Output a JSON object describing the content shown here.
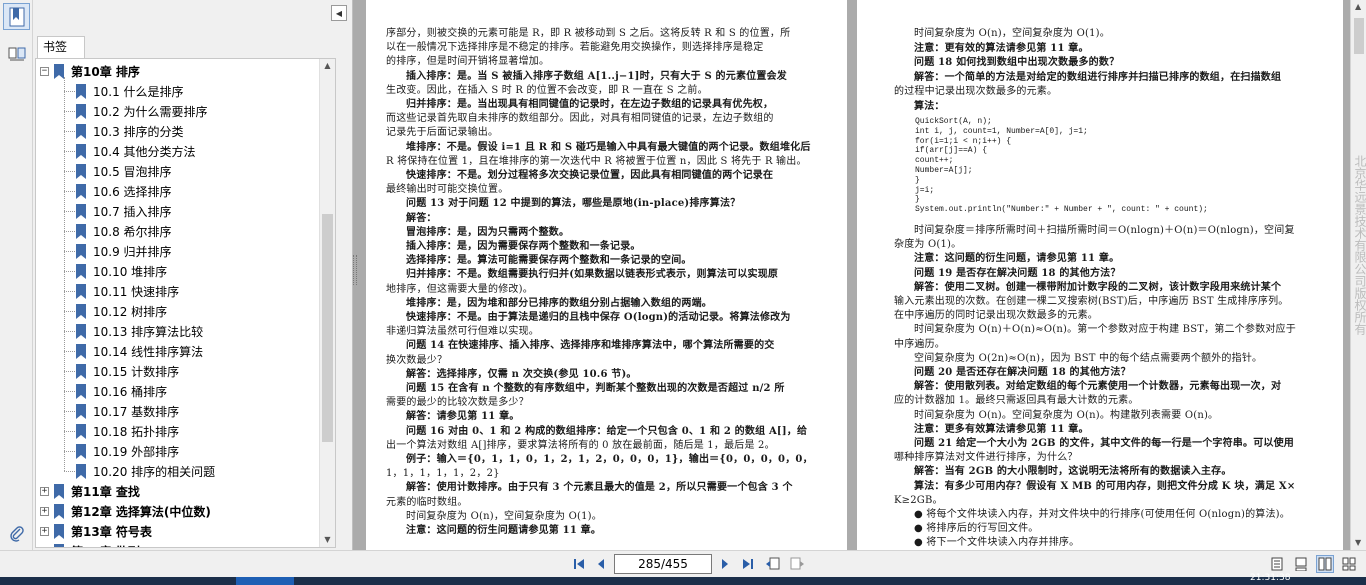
{
  "sidebar": {
    "tab_label": "书签",
    "collapse_label": "◀",
    "tree": [
      {
        "label": "第10章 排序",
        "level": 0,
        "expanded": true,
        "bold": true
      },
      {
        "label": "10.1 什么是排序",
        "level": 1
      },
      {
        "label": "10.2 为什么需要排序",
        "level": 1
      },
      {
        "label": "10.3 排序的分类",
        "level": 1
      },
      {
        "label": "10.4 其他分类方法",
        "level": 1
      },
      {
        "label": "10.5 冒泡排序",
        "level": 1
      },
      {
        "label": "10.6 选择排序",
        "level": 1
      },
      {
        "label": "10.7 插入排序",
        "level": 1
      },
      {
        "label": "10.8 希尔排序",
        "level": 1
      },
      {
        "label": "10.9 归并排序",
        "level": 1
      },
      {
        "label": "10.10 堆排序",
        "level": 1
      },
      {
        "label": "10.11 快速排序",
        "level": 1
      },
      {
        "label": "10.12 树排序",
        "level": 1
      },
      {
        "label": "10.13 排序算法比较",
        "level": 1
      },
      {
        "label": "10.14 线性排序算法",
        "level": 1
      },
      {
        "label": "10.15 计数排序",
        "level": 1
      },
      {
        "label": "10.16 桶排序",
        "level": 1
      },
      {
        "label": "10.17 基数排序",
        "level": 1
      },
      {
        "label": "10.18 拓扑排序",
        "level": 1
      },
      {
        "label": "10.19 外部排序",
        "level": 1
      },
      {
        "label": "10.20 排序的相关问题",
        "level": 1
      },
      {
        "label": "第11章 查找",
        "level": 0,
        "expanded": false,
        "bold": true
      },
      {
        "label": "第12章 选择算法(中位数)",
        "level": 0,
        "expanded": false,
        "bold": true
      },
      {
        "label": "第13章 符号表",
        "level": 0,
        "expanded": false,
        "bold": true
      },
      {
        "label": "第14章 散列",
        "level": 0,
        "expanded": false,
        "bold": true
      }
    ]
  },
  "page_left": {
    "lines": [
      {
        "text": "序部分，则被交换的元素可能是 R，即 R 被移动到 S 之后。这将反转 R 和 S 的位置，所",
        "indent": 0
      },
      {
        "text": "以在一般情况下选择排序是不稳定的排序。若能避免用交换操作，则选择排序是稳定",
        "indent": 0
      },
      {
        "text": "的排序，但是时间开销将显著增加。",
        "indent": 0
      },
      {
        "text": "插入排序：是。当 S 被插入排序子数组 A[1..j−1]时，只有大于 S 的元素位置会发",
        "indent": 1
      },
      {
        "text": "生改变。因此，在插入 S 时 R 的位置不会改变，即 R 一直在 S 之前。",
        "indent": 0
      },
      {
        "text": "归并排序：是。当出现具有相同键值的记录时，在左边子数组的记录具有优先权，",
        "indent": 1
      },
      {
        "text": "而这些记录首先取自未排序的数组部分。因此，对具有相同键值的记录，左边子数组的",
        "indent": 0
      },
      {
        "text": "记录先于后面记录输出。",
        "indent": 0
      },
      {
        "text": "堆排序：不是。假设 i=1 且 R 和 S 碰巧是输入中具有最大键值的两个记录。数组堆化后",
        "indent": 1
      },
      {
        "text": "R 将保持在位置 1，且在堆排序的第一次迭代中 R 将被置于位置 n，因此 S 将先于 R 输出。",
        "indent": 0
      },
      {
        "text": "快速排序：不是。划分过程将多次交换记录位置，因此具有相同键值的两个记录在",
        "indent": 1
      },
      {
        "text": "最终输出时可能交换位置。",
        "indent": 0
      },
      {
        "text": "问题 13   对于问题 12 中提到的算法，哪些是原地(in-place)排序算法？",
        "indent": 1
      },
      {
        "text": "解答：",
        "indent": 1
      },
      {
        "text": "冒泡排序：是，因为只需两个整数。",
        "indent": 1
      },
      {
        "text": "插入排序：是，因为需要保存两个整数和一条记录。",
        "indent": 1
      },
      {
        "text": "选择排序：是。算法可能需要保存两个整数和一条记录的空间。",
        "indent": 1
      },
      {
        "text": "归并排序：不是。数组需要执行归并(如果数据以链表形式表示，则算法可以实现原",
        "indent": 1
      },
      {
        "text": "地排序，但这需要大量的修改)。",
        "indent": 0
      },
      {
        "text": "堆排序：是，因为堆和部分已排序的数组分别占据输入数组的两端。",
        "indent": 1
      },
      {
        "text": "快速排序：不是。由于算法是递归的且栈中保存 O(logn)的活动记录。将算法修改为",
        "indent": 1
      },
      {
        "text": "非递归算法虽然可行但难以实现。",
        "indent": 0
      },
      {
        "text": "问题 14   在快速排序、插入排序、选择排序和堆排序算法中，哪个算法所需要的交",
        "indent": 1
      },
      {
        "text": "换次数最少？",
        "indent": 0
      },
      {
        "text": "解答：选择排序，仅需 n 次交换(参见 10.6 节)。",
        "indent": 1
      },
      {
        "text": "问题 15   在含有 n 个整数的有序数组中，判断某个整数出现的次数是否超过 n/2 所",
        "indent": 1
      },
      {
        "text": "需要的最少的比较次数是多少？",
        "indent": 0
      },
      {
        "text": "解答：请参见第 11 章。",
        "indent": 1
      },
      {
        "text": "问题 16   对由 0、1 和 2 构成的数组排序：给定一个只包含 0、1 和 2 的数组 A[]，给",
        "indent": 1
      },
      {
        "text": "出一个算法对数组 A[]排序，要求算法将所有的 0 放在最前面，随后是 1，最后是 2。",
        "indent": 0
      },
      {
        "text": "例子：输入＝{0，1，1，0，1，2，1，2，0，0，0，1}，输出＝{0，0，0，0，0，",
        "indent": 1
      },
      {
        "text": "1，1，1，1，1，2，2}",
        "indent": 0
      },
      {
        "text": "解答：使用计数排序。由于只有 3 个元素且最大的值是 2，所以只需要一个包含 3 个",
        "indent": 1
      },
      {
        "text": "元素的临时数组。",
        "indent": 0
      },
      {
        "text": "时间复杂度为 O(n)，空间复杂度为 O(1)。",
        "indent": 1
      },
      {
        "text": "注意：这问题的衍生问题请参见第 11 章。",
        "indent": 1
      }
    ]
  },
  "page_right": {
    "lines_top": [
      {
        "text": "时间复杂度为 O(n)，空间复杂度为 O(1)。",
        "indent": 1
      },
      {
        "text": "注意：更有效的算法请参见第 11 章。",
        "indent": 1
      },
      {
        "text": "问题 18   如何找到数组中出现次数最多的数？",
        "indent": 1
      },
      {
        "text": "解答：一个简单的方法是对给定的数组进行排序并扫描已排序的数组，在扫描数组",
        "indent": 1
      },
      {
        "text": "的过程中记录出现次数最多的元素。",
        "indent": 0
      },
      {
        "text": "算法：",
        "indent": 1
      }
    ],
    "code": [
      "QuickSort(A, n);",
      "int i, j, count=1, Number=A[0], j=1;",
      "for(i=1;i < n;i++) {",
      "        if(arr[j]==A) {",
      "                count++;",
      "                Number=A[j];",
      "        }",
      "        j=i;",
      "}",
      "System.out.println(\"Number:\" + Number + \", count: \" + count);"
    ],
    "lines_bottom": [
      {
        "text": "时间复杂度＝排序所需时间＋扫描所需时间＝O(nlogn)＋O(n)＝O(nlogn)，空间复",
        "indent": 1
      },
      {
        "text": "杂度为 O(1)。",
        "indent": 0
      },
      {
        "text": "注意：这问题的衍生问题，请参见第 11 章。",
        "indent": 1
      },
      {
        "text": "问题 19   是否存在解决问题 18 的其他方法？",
        "indent": 1
      },
      {
        "text": "解答：使用二叉树。创建一棵带附加计数字段的二叉树，该计数字段用来统计某个",
        "indent": 1
      },
      {
        "text": "输入元素出现的次数。在创建一棵二叉搜索树(BST)后，中序遍历 BST 生成排序序列。",
        "indent": 0
      },
      {
        "text": "在中序遍历的同时记录出现次数最多的元素。",
        "indent": 0
      },
      {
        "text": "时间复杂度为 O(n)＋O(n)≈O(n)。第一个参数对应于构建 BST，第二个参数对应于",
        "indent": 1
      },
      {
        "text": "中序遍历。",
        "indent": 0
      },
      {
        "text": "空间复杂度为 O(2n)≈O(n)，因为 BST 中的每个结点需要两个额外的指针。",
        "indent": 1
      },
      {
        "text": "问题 20   是否还存在解决问题 18 的其他方法？",
        "indent": 1
      },
      {
        "text": "解答：使用散列表。对给定数组的每个元素使用一个计数器，元素每出现一次，对",
        "indent": 1
      },
      {
        "text": "应的计数器加 1。最终只需返回具有最大计数的元素。",
        "indent": 0
      },
      {
        "text": "时间复杂度为 O(n)。空间复杂度为 O(n)。构建散列表需要 O(n)。",
        "indent": 1
      },
      {
        "text": "注意：更多有效算法请参见第 11 章。",
        "indent": 1
      },
      {
        "text": "问题 21   给定一个大小为 2GB 的文件，其中文件的每一行是一个字符串。可以使用",
        "indent": 1
      },
      {
        "text": "哪种排序算法对文件进行排序，为什么？",
        "indent": 0
      },
      {
        "text": "解答：当有 2GB 的大小限制时，这说明无法将所有的数据读入主存。",
        "indent": 1
      },
      {
        "text": "算法：有多少可用内存？假设有 X MB 的可用内存，则把文件分成 K 块，满足 X×",
        "indent": 1
      },
      {
        "text": "K≥2GB。",
        "indent": 0
      },
      {
        "text": "● 将每个文件块读入内存，并对文件块中的行排序(可使用任何 O(nlogn)的算法)。",
        "indent": 1
      },
      {
        "text": "● 将排序后的行写回文件。",
        "indent": 1
      },
      {
        "text": "● 将下一个文件块读入内存并排序。",
        "indent": 1
      }
    ]
  },
  "watermark": "北京华远景技术有限公司版权所有",
  "toolbar": {
    "page_display": "285/455"
  },
  "taskbar": {
    "clock": "21:31:38"
  },
  "colors": {
    "accent": "#1e5fb4",
    "bookmark_icon": "#3f6aa8",
    "viewer_bg": "#ababab"
  }
}
